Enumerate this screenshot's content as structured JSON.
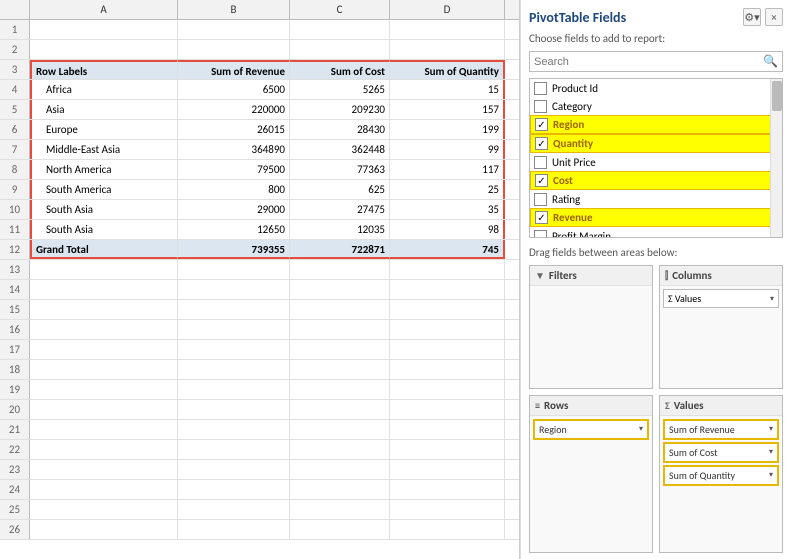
{
  "spreadsheet": {
    "col_headers": [
      "A",
      "B",
      "C",
      "D"
    ],
    "rows": [
      {
        "num": "1",
        "cells": [
          "",
          "",
          "",
          ""
        ]
      },
      {
        "num": "2",
        "cells": [
          "",
          "",
          "",
          ""
        ]
      },
      {
        "num": "3",
        "cells": [
          "Row Labels",
          "Sum of Revenue",
          "Sum of Cost",
          "Sum of Quantity"
        ],
        "type": "pivot-header"
      },
      {
        "num": "4",
        "cells": [
          "Africa",
          "6500",
          "5265",
          "15"
        ],
        "type": "pivot-data"
      },
      {
        "num": "5",
        "cells": [
          "Asia",
          "220000",
          "209230",
          "157"
        ],
        "type": "pivot-data"
      },
      {
        "num": "6",
        "cells": [
          "Europe",
          "26015",
          "28430",
          "199"
        ],
        "type": "pivot-data"
      },
      {
        "num": "7",
        "cells": [
          "Middle-East Asia",
          "364890",
          "362448",
          "99"
        ],
        "type": "pivot-data"
      },
      {
        "num": "8",
        "cells": [
          "North America",
          "79500",
          "77363",
          "117"
        ],
        "type": "pivot-data"
      },
      {
        "num": "9",
        "cells": [
          "South America",
          "800",
          "625",
          "25"
        ],
        "type": "pivot-data"
      },
      {
        "num": "10",
        "cells": [
          "South Asia",
          "29000",
          "27475",
          "35"
        ],
        "type": "pivot-data"
      },
      {
        "num": "11",
        "cells": [
          "South Asia",
          "12650",
          "12035",
          "98"
        ],
        "type": "pivot-data"
      },
      {
        "num": "12",
        "cells": [
          "Grand Total",
          "739355",
          "722871",
          "745"
        ],
        "type": "pivot-grand"
      },
      {
        "num": "13",
        "cells": [
          "",
          "",
          "",
          ""
        ]
      },
      {
        "num": "14",
        "cells": [
          "",
          "",
          "",
          ""
        ]
      },
      {
        "num": "15",
        "cells": [
          "",
          "",
          "",
          ""
        ]
      },
      {
        "num": "16",
        "cells": [
          "",
          "",
          "",
          ""
        ]
      },
      {
        "num": "17",
        "cells": [
          "",
          "",
          "",
          ""
        ]
      },
      {
        "num": "18",
        "cells": [
          "",
          "",
          "",
          ""
        ]
      },
      {
        "num": "19",
        "cells": [
          "",
          "",
          "",
          ""
        ]
      },
      {
        "num": "20",
        "cells": [
          "",
          "",
          "",
          ""
        ]
      },
      {
        "num": "21",
        "cells": [
          "",
          "",
          "",
          ""
        ]
      },
      {
        "num": "22",
        "cells": [
          "",
          "",
          "",
          ""
        ]
      },
      {
        "num": "23",
        "cells": [
          "",
          "",
          "",
          ""
        ]
      },
      {
        "num": "24",
        "cells": [
          "",
          "",
          "",
          ""
        ]
      },
      {
        "num": "25",
        "cells": [
          "",
          "",
          "",
          ""
        ]
      },
      {
        "num": "26",
        "cells": [
          "",
          "",
          "",
          ""
        ]
      }
    ]
  },
  "pivot_panel": {
    "title": "PivotTable Fields",
    "settings_icon": "⚙",
    "close_icon": "×",
    "subtitle": "Choose fields to add to report:",
    "search_placeholder": "Search",
    "fields": [
      {
        "label": "Product Id",
        "checked": false,
        "highlight": false
      },
      {
        "label": "Category",
        "checked": false,
        "highlight": false
      },
      {
        "label": "Region",
        "checked": true,
        "highlight": true
      },
      {
        "label": "Quantity",
        "checked": true,
        "highlight": true
      },
      {
        "label": "Unit Price",
        "checked": false,
        "highlight": false
      },
      {
        "label": "Cost",
        "checked": true,
        "highlight": true
      },
      {
        "label": "Rating",
        "checked": false,
        "highlight": false
      },
      {
        "label": "Revenue",
        "checked": true,
        "highlight": true
      },
      {
        "label": "Profit Margin",
        "checked": false,
        "highlight": false
      }
    ],
    "drag_label": "Drag fields between areas below:",
    "areas": {
      "filters": {
        "label": "Filters",
        "icon": "▼",
        "chips": []
      },
      "columns": {
        "label": "Columns",
        "icon": "|||",
        "chips": [
          {
            "text": "Σ Values",
            "dropdown": true
          }
        ]
      },
      "rows": {
        "label": "Rows",
        "icon": "≡",
        "chips": [
          {
            "text": "Region",
            "dropdown": true,
            "highlighted": true
          }
        ]
      },
      "values": {
        "label": "Values",
        "icon": "Σ",
        "chips": [
          {
            "text": "Sum of Revenue",
            "dropdown": true,
            "highlighted": true
          },
          {
            "text": "Sum of Cost",
            "dropdown": true,
            "highlighted": true
          },
          {
            "text": "Sum of Quantity",
            "dropdown": true,
            "highlighted": true
          }
        ]
      }
    }
  }
}
